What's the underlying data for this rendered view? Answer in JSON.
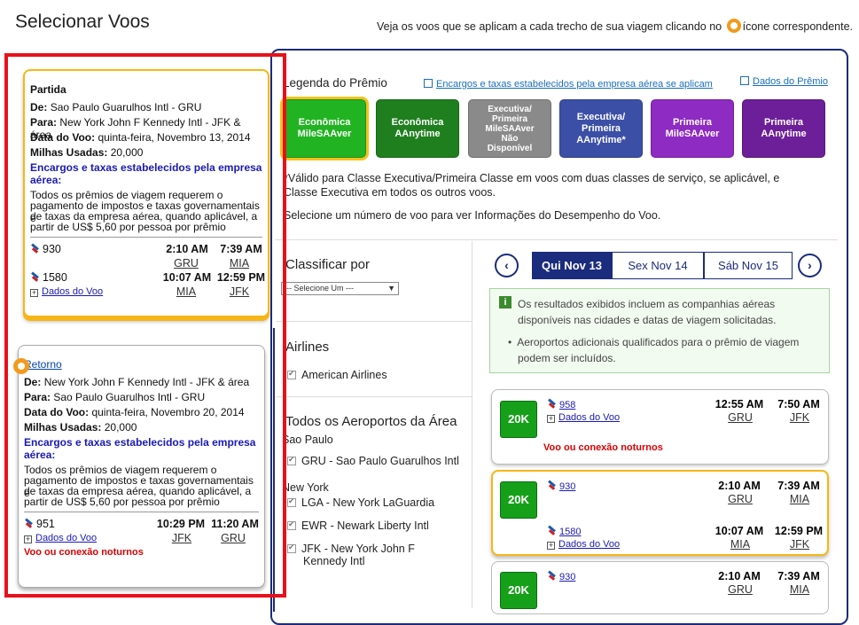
{
  "page": {
    "title": "Selecionar Voos",
    "hint_before": "Veja os voos que se aplicam a cada trecho de sua viagem clicando no",
    "hint_after": "ícone correspondente."
  },
  "partida": {
    "heading": "Partida",
    "de_label": "De:",
    "de_value": "Sao Paulo Guarulhos Intl - GRU",
    "para_label": "Para:",
    "para_value": "New York John F Kennedy Intl - JFK & área",
    "data_label": "Data do Voo:",
    "data_value": "quinta-feira, Novembro 13, 2014",
    "milhas_label": "Milhas Usadas:",
    "milhas_value": "20,000",
    "encargos": "Encargos e taxas estabelecidos pela empresa aérea:",
    "premios_1": "Todos os prêmios de viagem requerem o",
    "premios_2": "pagamento de impostos e taxas governamentais e",
    "premios_3": "de taxas da empresa aérea, quando aplicável, a",
    "premios_4": "partir de US$ 5,60 por pessoa por prêmio",
    "seg1": {
      "flight": "930",
      "dep": "2:10 AM",
      "arr": "7:39 AM",
      "from": "GRU",
      "to": "MIA"
    },
    "seg2": {
      "flight": "1580",
      "dep": "10:07 AM",
      "arr": "12:59 PM",
      "from": "MIA",
      "to": "JFK"
    },
    "details": "Dados do Voo"
  },
  "retorno": {
    "heading": "Retorno",
    "de_label": "De:",
    "de_value": "New York John F Kennedy Intl - JFK & área",
    "para_label": "Para:",
    "para_value": "Sao Paulo Guarulhos Intl - GRU",
    "data_label": "Data do Voo:",
    "data_value": "quinta-feira, Novembro 20, 2014",
    "milhas_label": "Milhas Usadas:",
    "milhas_value": "20,000",
    "encargos": "Encargos e taxas estabelecidos pela empresa aérea:",
    "premios_1": "Todos os prêmios de viagem requerem o",
    "premios_2": "pagamento de impostos e taxas governamentais e",
    "premios_3": "de taxas da empresa aérea, quando aplicável, a",
    "premios_4": "partir de US$ 5,60 por pessoa por prêmio",
    "seg1": {
      "flight": "951",
      "dep": "10:29 PM",
      "arr": "11:20 AM",
      "from": "JFK",
      "to": "GRU"
    },
    "details": "Dados do Voo",
    "overnight": "Voo ou conexão noturnos"
  },
  "legend": {
    "title": "Legenda do Prêmio",
    "encargos_link": "Encargos e taxas estabelecidos pela empresa aérea se aplicam",
    "dados_link": "Dados do Prêmio",
    "awards": [
      {
        "line1": "Econômica",
        "line2": "MileSAAver",
        "line3": "",
        "line4": "",
        "color": "#22b322"
      },
      {
        "line1": "Econômica",
        "line2": "AAnytime",
        "line3": "",
        "line4": "",
        "color": "#1f7f1f"
      },
      {
        "line1": "Executiva/",
        "line2": "Primeira",
        "line3": "MileSAAver",
        "line4": "Não Disponível",
        "color": "#8a8a8a"
      },
      {
        "line1": "Executiva/",
        "line2": "Primeira",
        "line3": "AAnytime*",
        "line4": "",
        "color": "#3c4fa6"
      },
      {
        "line1": "Primeira",
        "line2": "MileSAAver",
        "line3": "",
        "line4": "",
        "color": "#8e2bc2"
      },
      {
        "line1": "Primeira",
        "line2": "AAnytime",
        "line3": "",
        "line4": "",
        "color": "#6d1f99"
      }
    ],
    "note1a": "*Válido para Classe Executiva/Primeira Classe em voos com duas classes de serviço, se aplicável, e",
    "note1b": "Classe Executiva em todos os outros voos.",
    "note2": "Selecione um número de voo para ver Informações do Desempenho do Voo."
  },
  "filters": {
    "sort_title": "Classificar por",
    "sort_select": "--- Selecione Um ---",
    "airlines_title": "Airlines",
    "airline_1": "American Airlines",
    "airports_title": "Todos os Aeroportos da Área",
    "city_1": "Sao Paulo",
    "airport_gru": "GRU - Sao Paulo Guarulhos Intl",
    "city_2": "New York",
    "airport_lga": "LGA - New York LaGuardia",
    "airport_ewr": "EWR - Newark Liberty Intl",
    "airport_jfk_1": "JFK - New York John F",
    "airport_jfk_2": "Kennedy Intl"
  },
  "days": {
    "prev": "‹",
    "next": "›",
    "day1": "Qui Nov 13",
    "day2": "Sex Nov 14",
    "day3": "Sáb Nov 15"
  },
  "info": {
    "line1": "Os resultados exibidos incluem as companhias aéreas",
    "line2": "disponíveis nas cidades e datas de viagem solicitadas.",
    "line3": "Aeroportos adicionais qualificados para o prêmio de viagem",
    "line4": "podem ser incluídos."
  },
  "results": {
    "r1": {
      "miles": "20K",
      "flight": "958",
      "dep": "12:55 AM",
      "arr": "7:50 AM",
      "from": "GRU",
      "to": "JFK",
      "details": "Dados do Voo",
      "overnight": "Voo ou conexão noturnos"
    },
    "r2": {
      "miles": "20K",
      "flight1": "930",
      "dep1": "2:10 AM",
      "arr1": "7:39 AM",
      "from1": "GRU",
      "to1": "MIA",
      "flight2": "1580",
      "dep2": "10:07 AM",
      "arr2": "12:59 PM",
      "from2": "MIA",
      "to2": "JFK",
      "details": "Dados do Voo"
    },
    "r3": {
      "miles": "20K",
      "flight": "930",
      "dep": "2:10 AM",
      "arr": "7:39 AM",
      "from": "GRU",
      "to": "MIA"
    }
  }
}
